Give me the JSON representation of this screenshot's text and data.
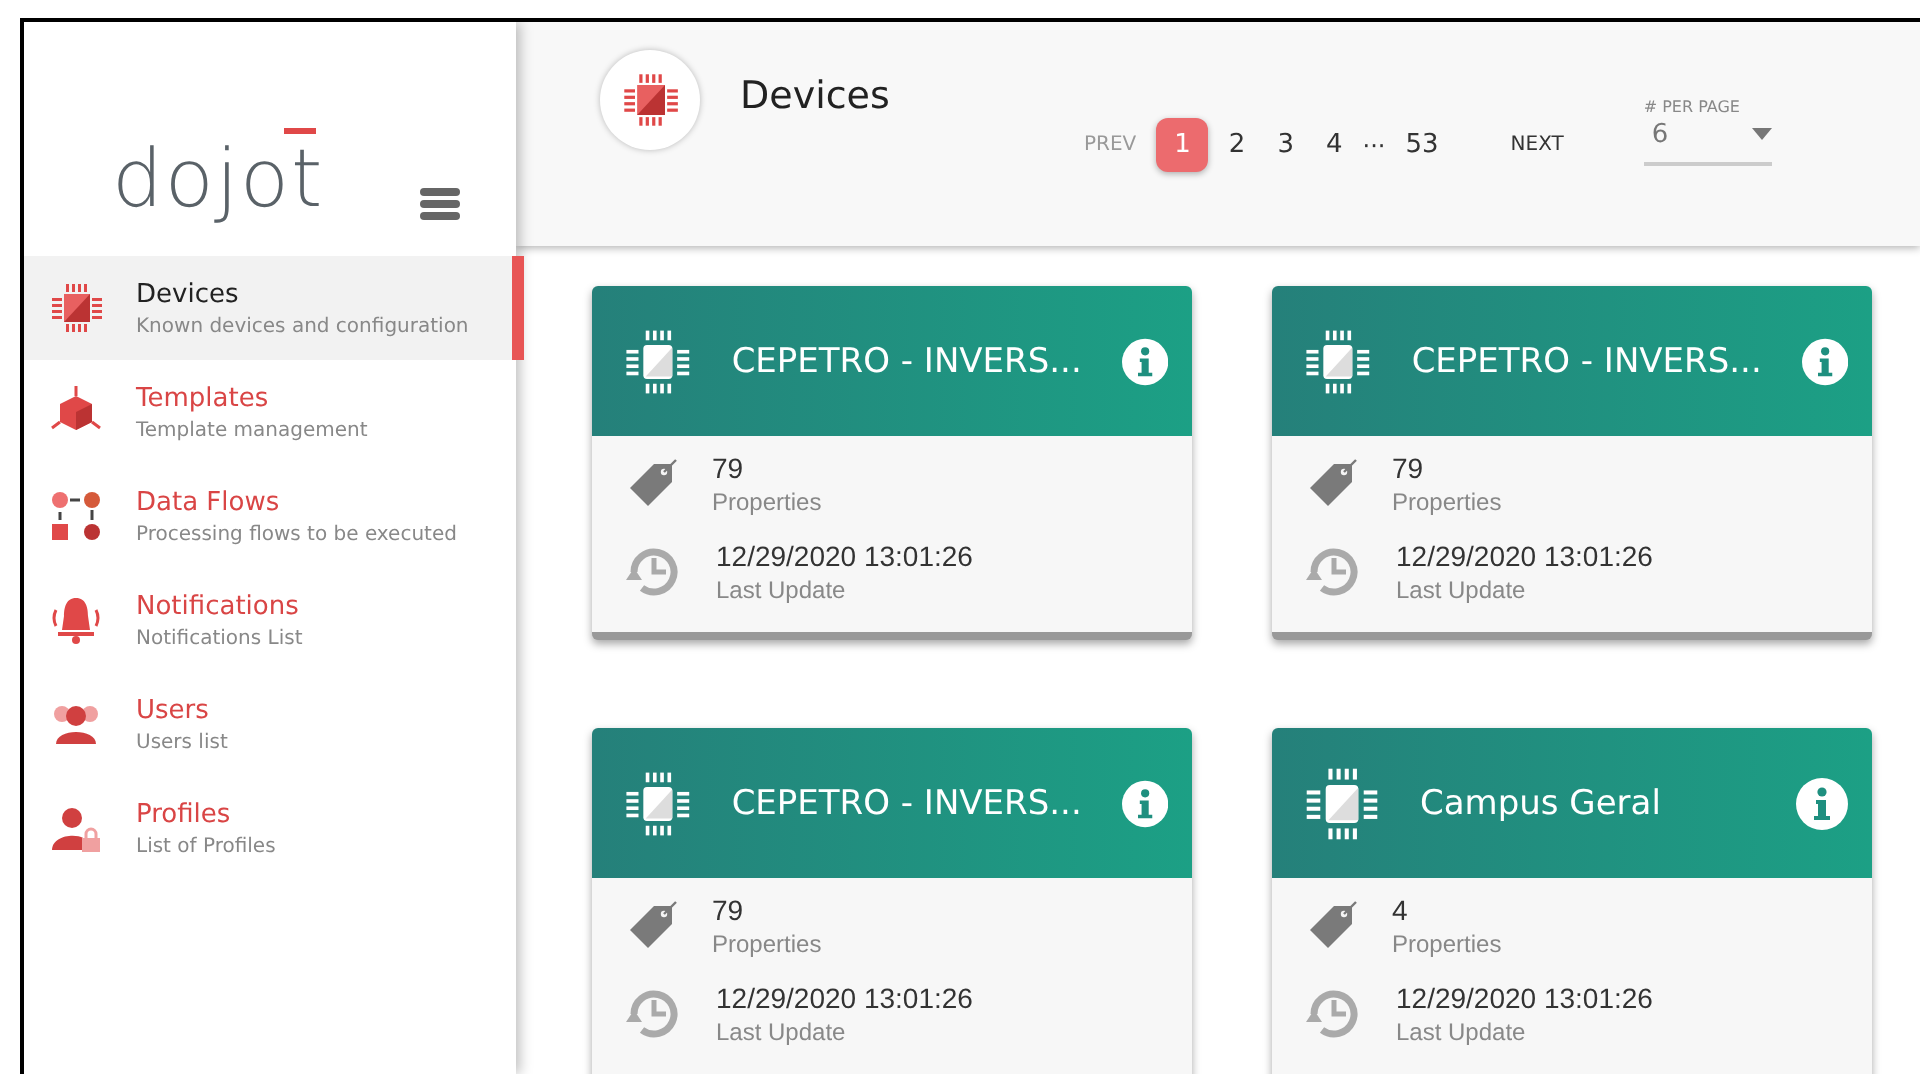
{
  "sidebar": {
    "logo": "dojot",
    "items": [
      {
        "kind": "devices",
        "title": "Devices",
        "subtitle": "Known devices and configuration",
        "selected": true
      },
      {
        "kind": "templates",
        "title": "Templates",
        "subtitle": "Template management",
        "selected": false
      },
      {
        "kind": "flows",
        "title": "Data Flows",
        "subtitle": "Processing flows to be executed",
        "selected": false
      },
      {
        "kind": "notifications",
        "title": "Notifications",
        "subtitle": "Notifications List",
        "selected": false
      },
      {
        "kind": "users",
        "title": "Users",
        "subtitle": "Users list",
        "selected": false
      },
      {
        "kind": "profiles",
        "title": "Profiles",
        "subtitle": "List of Profiles",
        "selected": false
      }
    ]
  },
  "header": {
    "title": "Devices",
    "pagination": {
      "prev": "PREV",
      "pages": [
        {
          "label": "1",
          "selected": true
        },
        {
          "label": "2",
          "selected": false
        },
        {
          "label": "3",
          "selected": false
        },
        {
          "label": "4",
          "selected": false
        }
      ],
      "ellipsis": "···",
      "last": "53",
      "next": "NEXT"
    },
    "per_page": {
      "label": "# PER PAGE",
      "value": "6"
    }
  },
  "cards": [
    {
      "name": "CEPETRO - INVERS...",
      "properties": "79",
      "properties_label": "Properties",
      "updated": "12/29/2020 13:01:26",
      "updated_label": "Last Update"
    },
    {
      "name": "CEPETRO - INVERS...",
      "properties": "79",
      "properties_label": "Properties",
      "updated": "12/29/2020 13:01:26",
      "updated_label": "Last Update"
    },
    {
      "name": "CEPETRO - INVERS...",
      "properties": "79",
      "properties_label": "Properties",
      "updated": "12/29/2020 13:01:26",
      "updated_label": "Last Update"
    },
    {
      "name": "Campus Geral",
      "properties": "4",
      "properties_label": "Properties",
      "updated": "12/29/2020 13:01:26",
      "updated_label": "Last Update"
    }
  ]
}
